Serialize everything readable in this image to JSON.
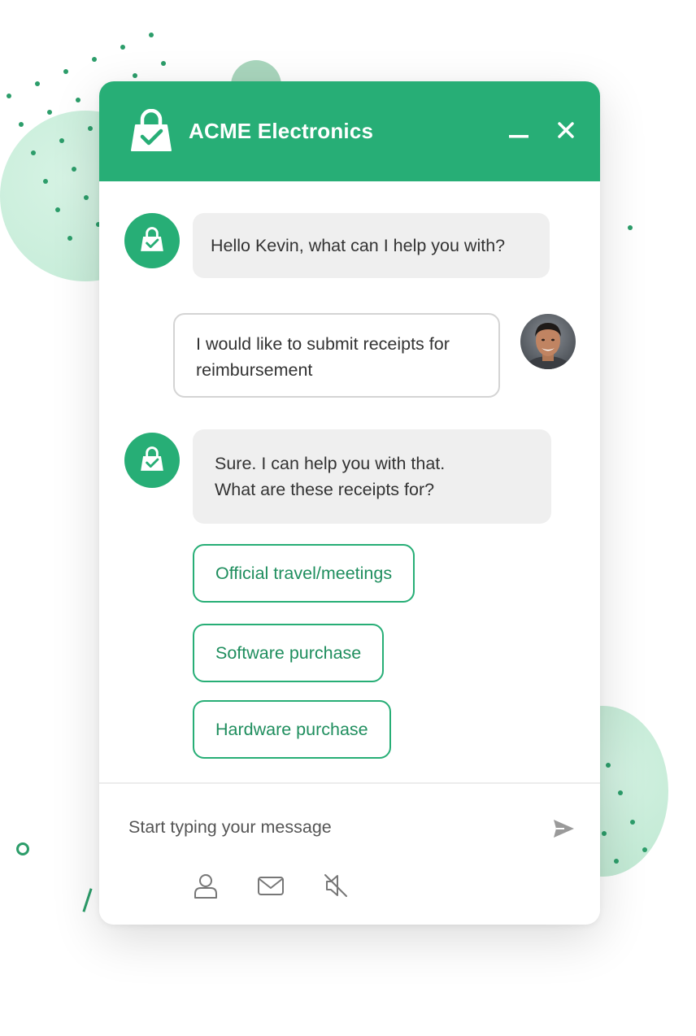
{
  "header": {
    "title": "ACME Electronics"
  },
  "messages": [
    {
      "sender": "bot",
      "lines": [
        "Hello Kevin, what can I help you with?"
      ]
    },
    {
      "sender": "user",
      "lines": [
        "I would like to submit receipts for",
        "reimbursement"
      ]
    },
    {
      "sender": "bot",
      "lines": [
        "Sure. I can help you with that.",
        "What are these receipts for?"
      ]
    }
  ],
  "quick_replies": [
    "Official travel/meetings",
    "Software purchase",
    "Hardware purchase"
  ],
  "composer": {
    "placeholder": "Start typing your message"
  },
  "icons": {
    "brand_logo": "shopping-bag-check-icon",
    "minimize": "minimize-icon",
    "close": "close-icon",
    "send": "send-icon",
    "profile": "user-icon",
    "email": "envelope-icon",
    "mute": "speaker-off-icon"
  },
  "colors": {
    "brand": "#27ae76",
    "option_text": "#1f8e5e",
    "bot_bubble": "#efefef",
    "user_bubble_border": "#d4d4d4"
  }
}
